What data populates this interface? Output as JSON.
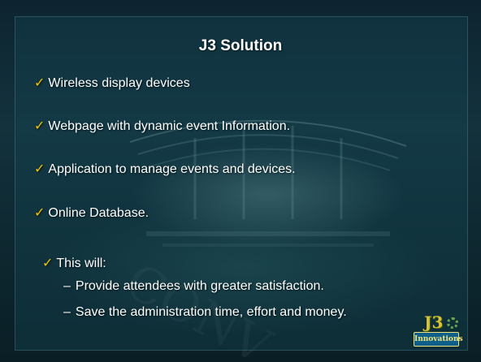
{
  "slide": {
    "title": "J3 Solution",
    "bullets": [
      "Wireless display devices",
      "Webpage with dynamic event Information.",
      "Application to manage events and devices.",
      "Online Database."
    ],
    "summary_label": "This will:",
    "sub_bullets": [
      "Provide attendees with greater satisfaction.",
      "Save the administration time, effort and money."
    ],
    "logo_text": "Innovations",
    "logo_mark": "J3"
  },
  "colors": {
    "check": "#f2c200",
    "text": "#ffffff",
    "panel": "#14465 5"
  },
  "icons": {
    "bullet": "checkmark-icon",
    "sub_bullet": "dash"
  }
}
